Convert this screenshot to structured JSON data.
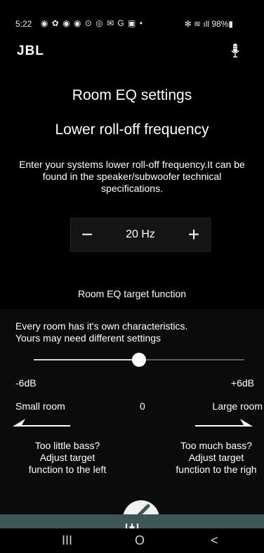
{
  "status_bar": {
    "time": "5:22",
    "notification_icons": "◉ ✿ ◉ ◉ ⊙ ◎ ✉ G ▣ •",
    "right": "✻ ≋ ıll 98%▮"
  },
  "header": {
    "logo": "JBL",
    "mic_icon": "microphone-icon"
  },
  "screen": {
    "title": "Room EQ settings",
    "subtitle": "Lower roll-off frequency",
    "description": "Enter your systems lower roll-off frequency.It can be found in the speaker/subwoofer technical specifications."
  },
  "stepper": {
    "minus_label": "−",
    "value": "20 Hz",
    "plus_label": "+"
  },
  "eq_target": {
    "label": "Room EQ target function",
    "description_line1": "Every room has it's own characteristics.",
    "description_line2": "Yours may need different settings",
    "slider": {
      "min_label": "-6dB",
      "max_label": "+6dB",
      "value_fraction": 0.5
    },
    "small_room_label": "Small room",
    "center_value": "0",
    "large_room_label": "Large room",
    "hint_left_line1": "Too little bass?",
    "hint_left_line2": "Adjust target",
    "hint_left_line3": "function to the left",
    "hint_right_line1": "Too much bass?",
    "hint_right_line2": "Adjust target",
    "hint_right_line3": "function to the righ"
  },
  "bottom_bar": {
    "color": "#3d5656",
    "icon": "equalizer-icon"
  },
  "nav": {
    "recents": "III",
    "home": "O",
    "back": "<"
  }
}
